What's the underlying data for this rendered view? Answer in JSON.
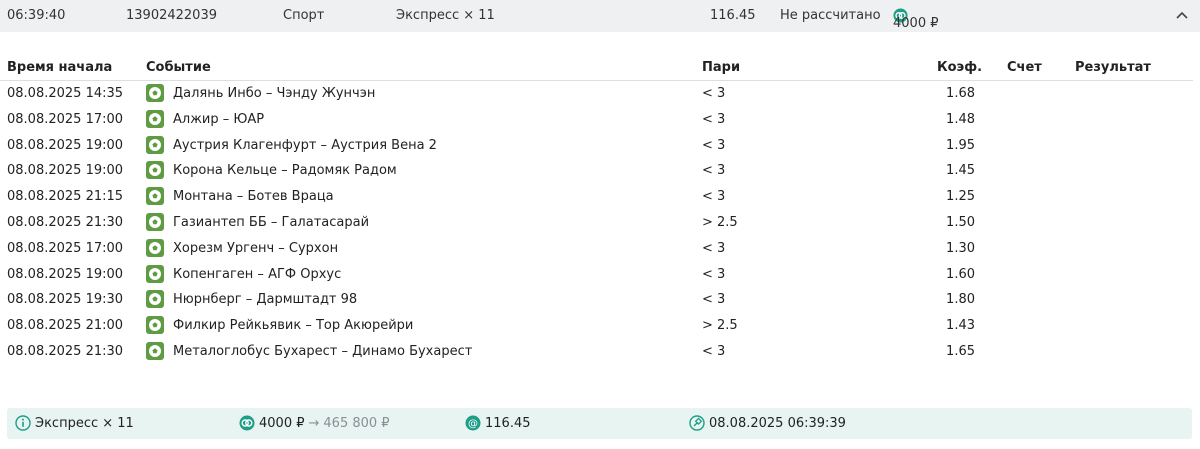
{
  "header": {
    "time": "06:39:40",
    "bet_id": "13902422039",
    "sport": "Спорт",
    "type": "Экспресс × 11",
    "coef": "116.45",
    "status": "Не рассчитано",
    "amount": "4000 ₽",
    "collapse_icon": "chevron-up-icon"
  },
  "table": {
    "columns": {
      "start_time": "Время начала",
      "event": "Событие",
      "bet": "Пари",
      "coef": "Коэф.",
      "score": "Счет",
      "result": "Результат"
    },
    "rows": [
      {
        "time": "08.08.2025 14:35",
        "event": "Далянь Инбо – Чэнду Жунчэн",
        "bet": "< 3",
        "coef": "1.68"
      },
      {
        "time": "08.08.2025 17:00",
        "event": "Алжир – ЮАР",
        "bet": "< 3",
        "coef": "1.48"
      },
      {
        "time": "08.08.2025 19:00",
        "event": "Аустрия Клагенфурт – Аустрия Вена 2",
        "bet": "< 3",
        "coef": "1.95"
      },
      {
        "time": "08.08.2025 19:00",
        "event": "Корона Кельце – Радомяк Радом",
        "bet": "< 3",
        "coef": "1.45"
      },
      {
        "time": "08.08.2025 21:15",
        "event": "Монтана – Ботев Враца",
        "bet": "< 3",
        "coef": "1.25"
      },
      {
        "time": "08.08.2025 21:30",
        "event": "Газиантеп ББ – Галатасарай",
        "bet": "> 2.5",
        "coef": "1.50"
      },
      {
        "time": "08.08.2025 17:00",
        "event": "Хорезм Ургенч – Сурхон",
        "bet": "< 3",
        "coef": "1.30"
      },
      {
        "time": "08.08.2025 19:00",
        "event": "Копенгаген – АГФ Орхус",
        "bet": "< 3",
        "coef": "1.60"
      },
      {
        "time": "08.08.2025 19:30",
        "event": "Нюрнберг – Дармштадт 98",
        "bet": "< 3",
        "coef": "1.80"
      },
      {
        "time": "08.08.2025 21:00",
        "event": "Филкир Рейкьявик – Тор Акюрейри",
        "bet": "> 2.5",
        "coef": "1.43"
      },
      {
        "time": "08.08.2025 21:30",
        "event": "Металоглобус Бухарест – Динамо Бухарест",
        "bet": "< 3",
        "coef": "1.65"
      }
    ]
  },
  "footer": {
    "type": "Экспресс × 11",
    "stake": "4000 ₽",
    "arrow": "→",
    "payout": "465 800 ₽",
    "coef": "116.45",
    "date": "08.08.2025 06:39:39"
  },
  "colors": {
    "accent": "#1e9e86",
    "sport_icon_bg": "#5f9b42",
    "footer_bg": "#e7f4f2",
    "header_bg": "#eef0f2"
  }
}
